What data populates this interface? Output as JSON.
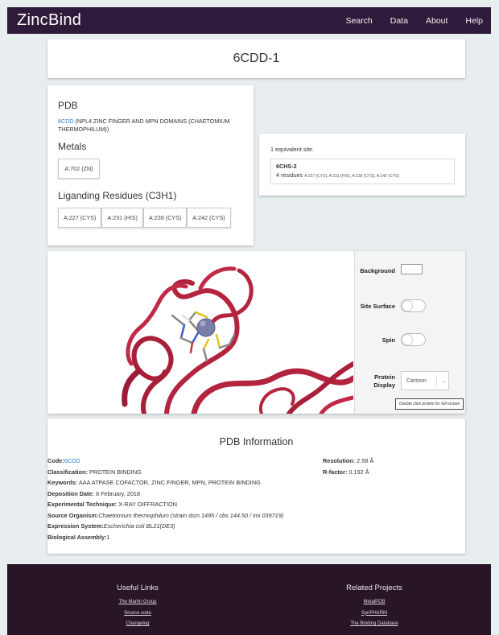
{
  "header": {
    "brand": "ZincBind",
    "nav": [
      "Search",
      "Data",
      "About",
      "Help"
    ]
  },
  "site_title": "6CDD-1",
  "pdb_section": {
    "heading": "PDB",
    "code": "6CDD",
    "description": " (NPL4 ZINC FINGER AND MPN DOMAINS (CHAETOMIUM THERMOPHILUM))"
  },
  "metals_section": {
    "heading": "Metals",
    "metals": [
      "A:702 (ZN)"
    ]
  },
  "residues_section": {
    "heading": "Liganding Residues (C3H1)",
    "residues": [
      "A:227 (CYS)",
      "A:231 (HIS)",
      "A:239 (CYS)",
      "A:242 (CYS)"
    ]
  },
  "equivalent": {
    "count_text": "1 equivalent site.",
    "site_code": "6CHS-2",
    "residue_count": "4 residues",
    "residue_list": "A:227 (CYS), A:231 (HIS), A:239 (CYS), A:242 (CYS)"
  },
  "viewer": {
    "background_label": "Background",
    "background_color": "#ffffff",
    "site_surface_label": "Site Surface",
    "spin_label": "Spin",
    "protein_display_label_1": "Protein",
    "protein_display_label_2": "Display",
    "protein_display_value": "Cartoon",
    "hint": "Double click protein for full-screen",
    "ribbon_color": "#b3243f",
    "metal_color": "#7a7fa8"
  },
  "pdb_info": {
    "heading": "PDB Information",
    "code_label": "Code:",
    "code_value": "6CDD",
    "classification_label": "Classification:",
    "classification_value": " PROTEIN BINDING",
    "keywords_label": "Keywords:",
    "keywords_value": " AAA ATPASE COFACTOR, ZINC FINGER, MPN, PROTEIN BINDING",
    "deposition_label": "Deposition Date:",
    "deposition_value": " 8 February, 2018",
    "technique_label": "Experimental Technique:",
    "technique_value": " X-RAY DIFFRACTION",
    "organism_label": "Source Organism:",
    "organism_value": "Chaetomium thermophilum (strain dsm 1495 / cbs 144.50 / imi 039719)",
    "expression_label": "Expression System:",
    "expression_value": "Escherichia coli BL21(DE3)",
    "assembly_label": "Biological Assembly:",
    "assembly_value": "1",
    "resolution_label": "Resolution:",
    "resolution_value": " 2.58 Å",
    "rfactor_label": "R-factor:",
    "rfactor_value": " 0.192 Å"
  },
  "footer": {
    "useful_heading": "Useful Links",
    "useful_links": [
      "The Martin Group",
      "Source code",
      "Changelog"
    ],
    "related_heading": "Related Projects",
    "related_links": [
      "MetalPDB",
      "SynPHARM",
      "The Binding Database"
    ]
  }
}
